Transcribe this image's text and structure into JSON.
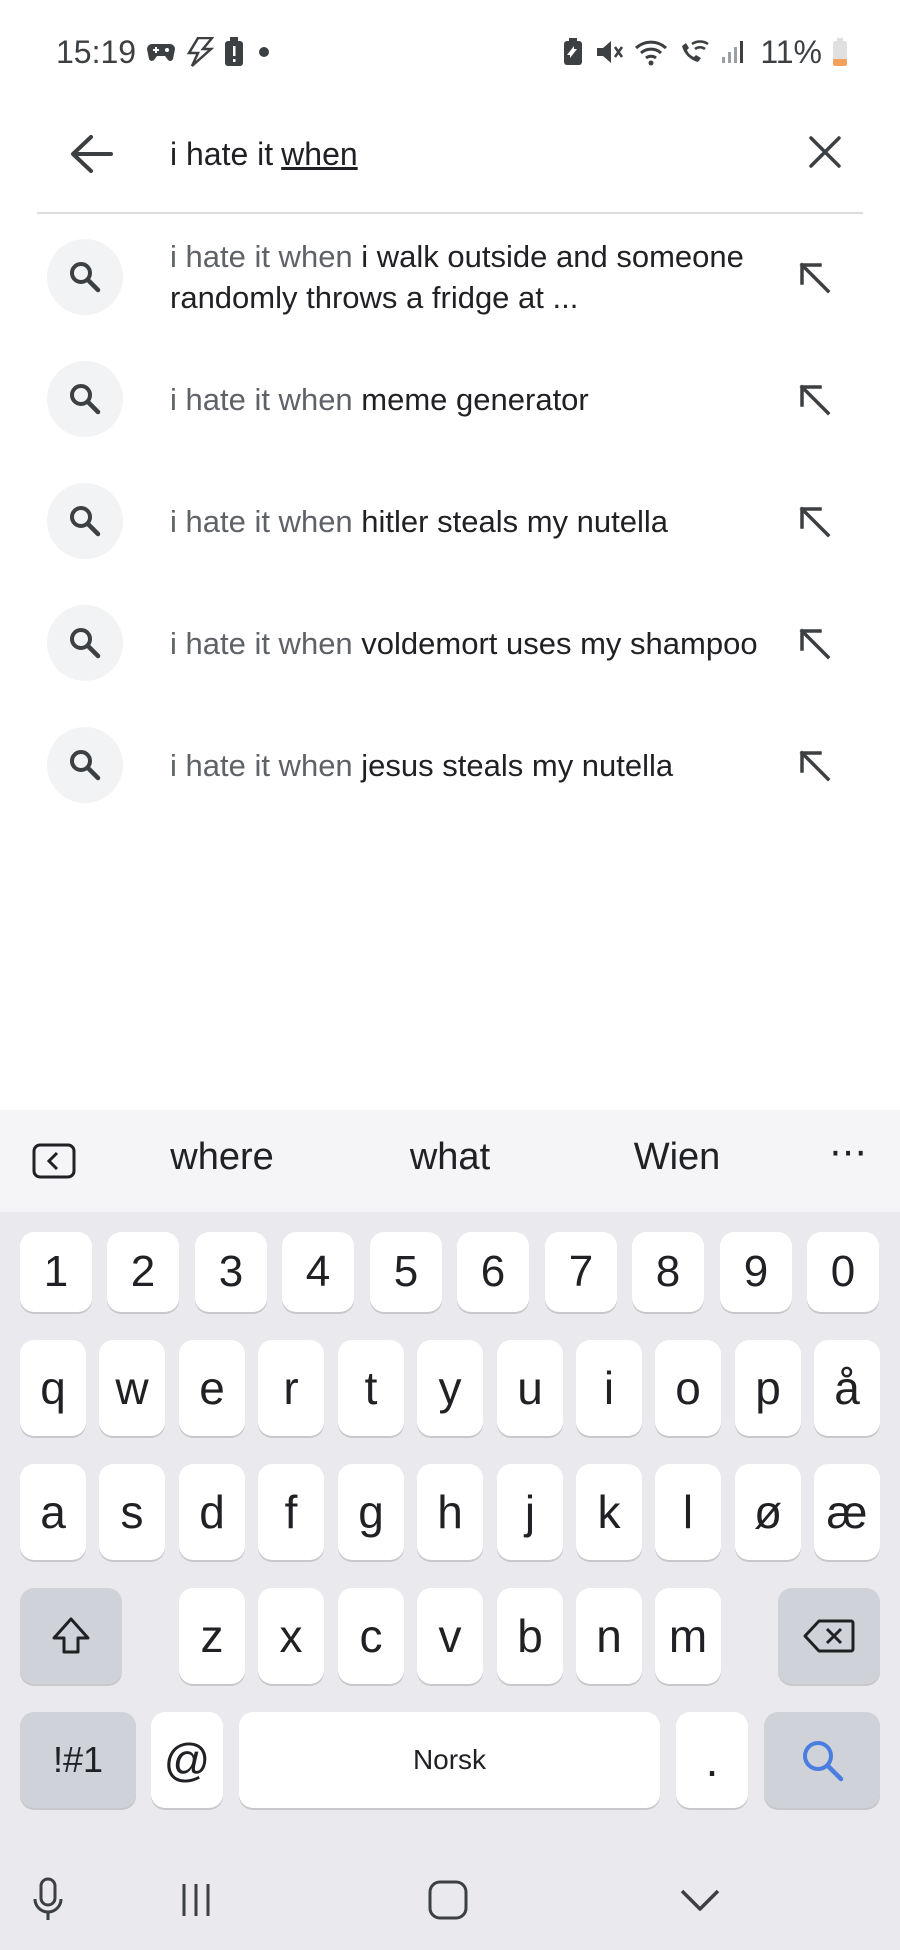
{
  "status_bar": {
    "time": "15:19",
    "battery": "11%",
    "icons_left": [
      "game-controller-icon",
      "flash-icon",
      "alert-battery-icon",
      "dot-icon"
    ],
    "icons_right": [
      "battery-saver-icon",
      "mute-icon",
      "wifi-icon",
      "wifi-call-icon",
      "signal-icon"
    ]
  },
  "search": {
    "query_plain": "i hate it",
    "query_underlined": "when"
  },
  "suggestions": [
    {
      "prefix": "i hate it when",
      "rest": "i walk outside and someone randomly throws a fridge at ..."
    },
    {
      "prefix": "i hate it when",
      "rest": "meme generator"
    },
    {
      "prefix": "i hate it when",
      "rest": "hitler steals my nutella"
    },
    {
      "prefix": "i hate it when",
      "rest": "voldemort uses my shampoo"
    },
    {
      "prefix": "i hate it when",
      "rest": "jesus steals my nutella"
    }
  ],
  "keyboard": {
    "word_suggestions": [
      "where",
      "what",
      "Wien"
    ],
    "more": "⋯",
    "number_row": [
      "1",
      "2",
      "3",
      "4",
      "5",
      "6",
      "7",
      "8",
      "9",
      "0"
    ],
    "row1": [
      "q",
      "w",
      "e",
      "r",
      "t",
      "y",
      "u",
      "i",
      "o",
      "p",
      "å"
    ],
    "row2": [
      "a",
      "s",
      "d",
      "f",
      "g",
      "h",
      "j",
      "k",
      "l",
      "ø",
      "æ"
    ],
    "row3": [
      "z",
      "x",
      "c",
      "v",
      "b",
      "n",
      "m"
    ],
    "symbols_label": "!#1",
    "at_label": "@",
    "space_label": "Norsk",
    "period_label": "."
  },
  "colors": {
    "accent_blue": "#4a7de0",
    "keyboard_bg": "#e9e9ee"
  }
}
